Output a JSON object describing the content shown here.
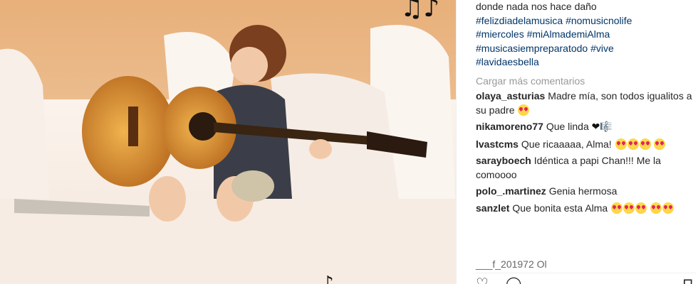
{
  "post": {
    "photo": {
      "music_notes_glyph": "♫♪"
    },
    "caption_lines": [
      "donde nada nos hace daño",
      "#felizdiadelamusica #nomusicnolife",
      "#miercoles #miAlmademiAlma",
      "#musicasiempreparatodo #vive",
      "#lavidaesbella"
    ],
    "load_more": "Cargar más comentarios",
    "comments": [
      {
        "user": "olaya_asturias",
        "text": "Madre mía, son todos igualitos a su padre",
        "emoji": 1
      },
      {
        "user": "nikamoreno77",
        "text": "Que linda",
        "symbol": "❤🎼"
      },
      {
        "user": "lvastcms",
        "text": "Que ricaaaaa, Alma!",
        "emoji": 4
      },
      {
        "user": "sarayboech",
        "text": "Idéntica a papi Chan!!! Me la comoooo",
        "emoji": 0
      },
      {
        "user": "polo_.martinez",
        "text": "Genia hermosa",
        "emoji": 0
      },
      {
        "user": "sanzlet",
        "text": "Que bonita esta Alma",
        "emoji": 5
      }
    ],
    "peek_comment": "___f_201972 Ol",
    "actions": {
      "like_icon": "♡",
      "comment_icon": "◯",
      "save_icon": "⊓"
    },
    "colors": {
      "tag": "#003569",
      "muted": "#999999",
      "text": "#262626"
    }
  }
}
